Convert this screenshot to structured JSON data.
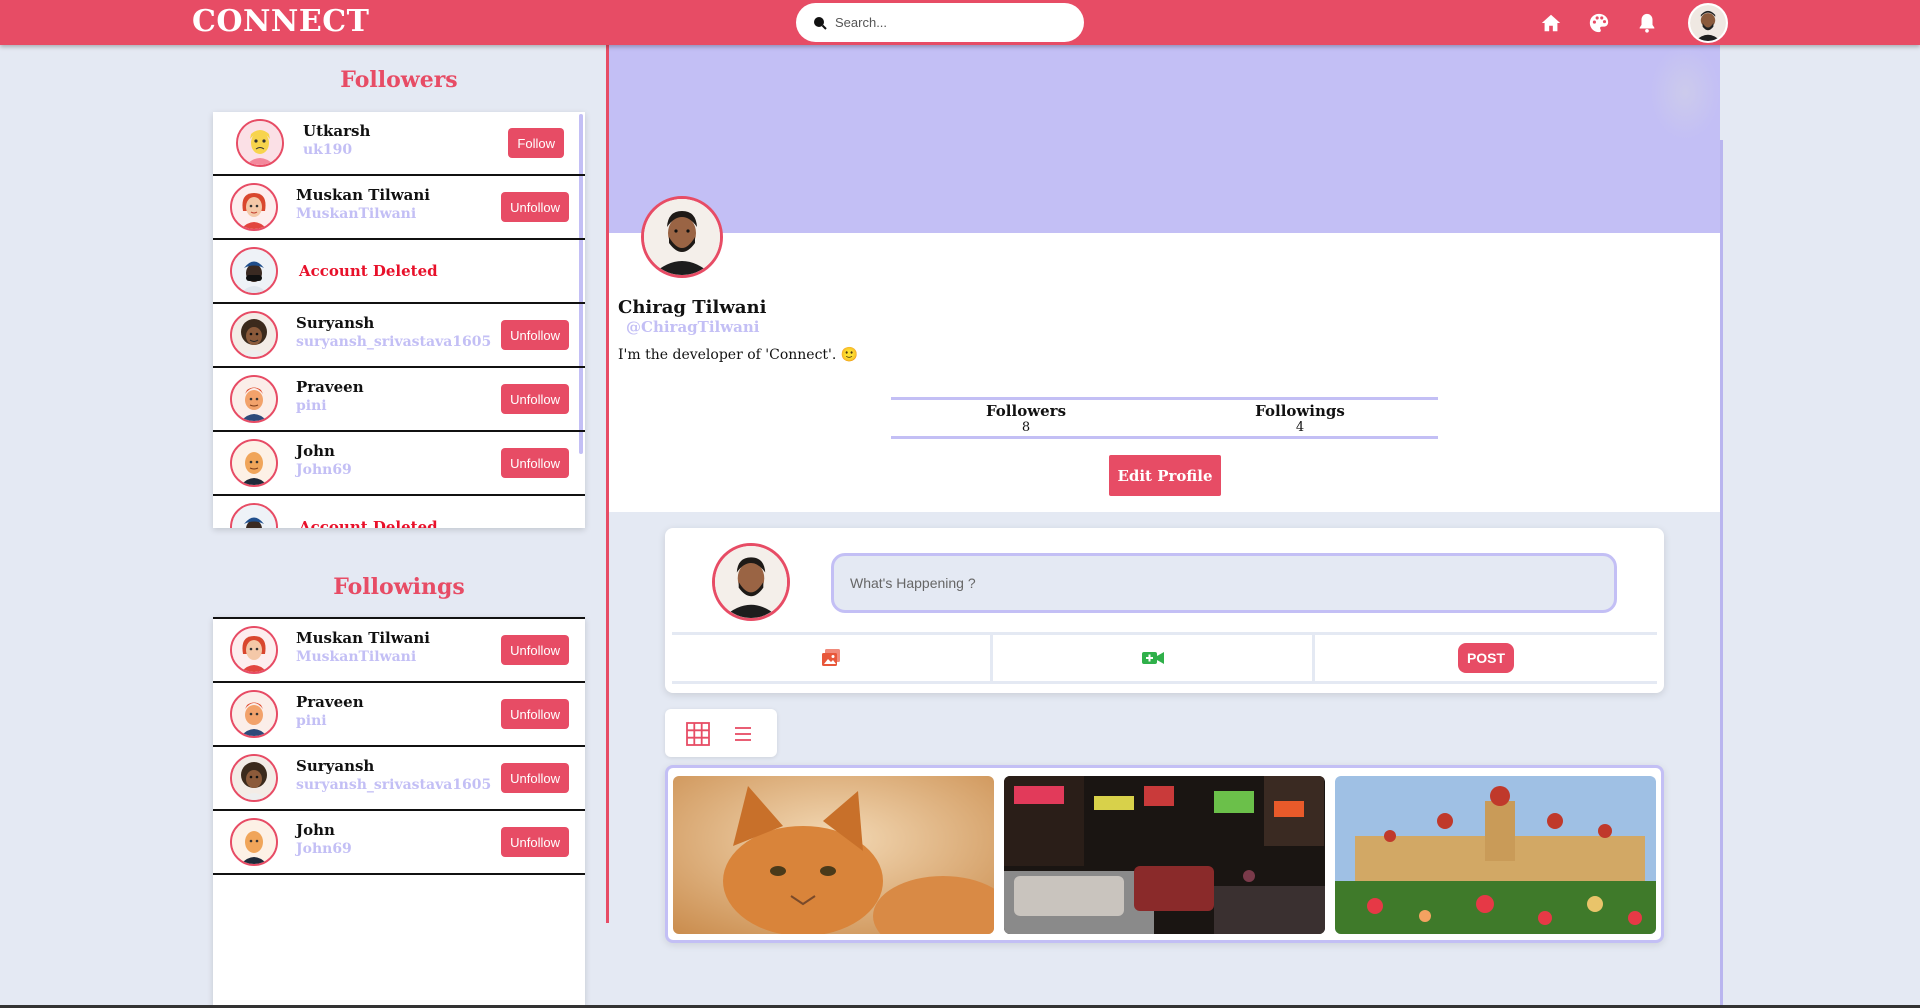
{
  "header": {
    "brand": "CONNECT",
    "search_placeholder": "Search...",
    "icons": [
      "home-icon",
      "palette-icon",
      "bell-icon",
      "profile-avatar"
    ]
  },
  "followers": {
    "title": "Followers",
    "items": [
      {
        "name": "Utkarsh",
        "username": "uk190",
        "action": "Follow",
        "deleted": false
      },
      {
        "name": "Muskan Tilwani",
        "username": "MuskanTilwani",
        "action": "Unfollow",
        "deleted": false
      },
      {
        "name": "Account Deleted",
        "username": "",
        "action": "",
        "deleted": true
      },
      {
        "name": "Suryansh",
        "username": "suryansh_srivastava1605",
        "action": "Unfollow",
        "deleted": false
      },
      {
        "name": "Praveen",
        "username": "pini",
        "action": "Unfollow",
        "deleted": false
      },
      {
        "name": "John",
        "username": "John69",
        "action": "Unfollow",
        "deleted": false
      },
      {
        "name": "Account Deleted",
        "username": "",
        "action": "",
        "deleted": true
      }
    ]
  },
  "followings": {
    "title": "Followings",
    "items": [
      {
        "name": "Muskan Tilwani",
        "username": "MuskanTilwani",
        "action": "Unfollow"
      },
      {
        "name": "Praveen",
        "username": "pini",
        "action": "Unfollow"
      },
      {
        "name": "Suryansh",
        "username": "suryansh_srivastava1605",
        "action": "Unfollow"
      },
      {
        "name": "John",
        "username": "John69",
        "action": "Unfollow"
      }
    ]
  },
  "profile": {
    "name": "Chirag Tilwani",
    "handle": "@ChiragTilwani",
    "bio": "I'm the developer of 'Connect'. 🙂",
    "followers_label": "Followers",
    "followers_count": "8",
    "followings_label": "Followings",
    "followings_count": "4",
    "edit_label": "Edit Profile"
  },
  "composer": {
    "placeholder": "What's Happening ?",
    "photo_icon": "image-icon",
    "video_icon": "video-add-icon",
    "post_label": "POST"
  },
  "view_toggle": {
    "options": [
      "grid-icon",
      "list-icon"
    ]
  },
  "gallery": {
    "photos": [
      "cat-photo",
      "street-photo",
      "palace-photo"
    ]
  },
  "colors": {
    "accent": "#e74c65",
    "lavender": "#c3bff5",
    "page_bg": "#e4e9f3",
    "deleted": "#e8102a"
  }
}
